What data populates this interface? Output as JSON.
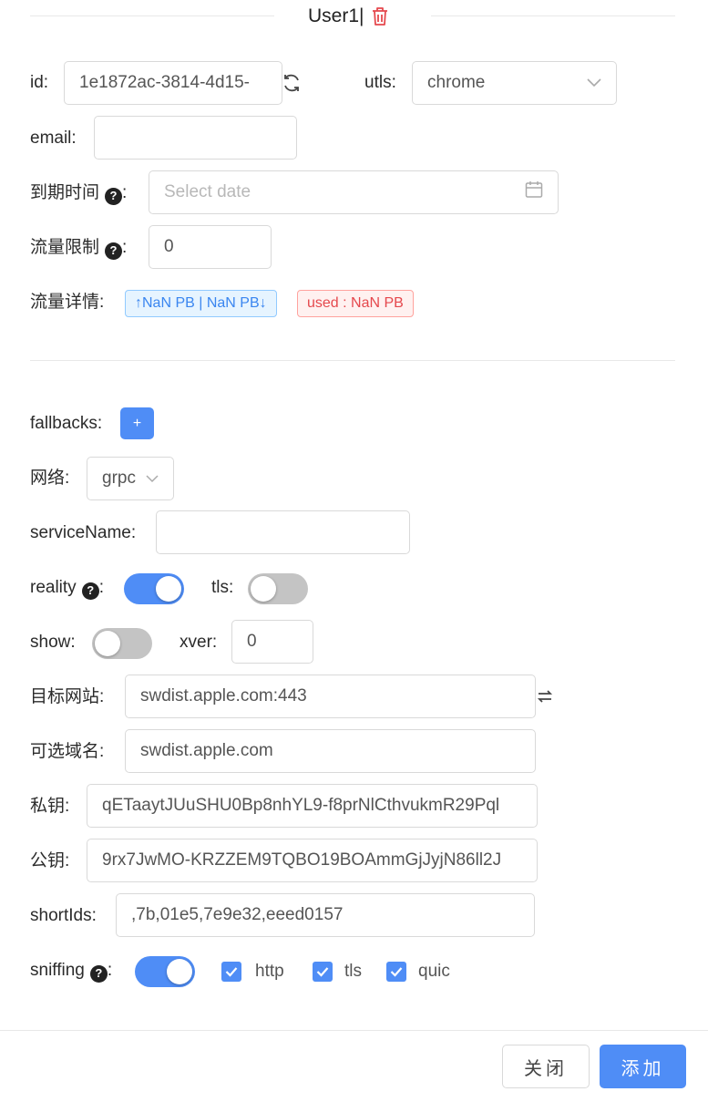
{
  "header": {
    "title": "User1|"
  },
  "client": {
    "id_label": "id",
    "id_value": "1e1872ac-3814-4d15-",
    "utls_label": "utls",
    "utls_value": "chrome",
    "email_label": "email",
    "email_value": "",
    "expiry_label": "到期时间",
    "expiry_placeholder": "Select date",
    "traffic_limit_label": "流量限制",
    "traffic_limit_value": "0",
    "traffic_detail_label": "流量详情",
    "traffic_tag_updown": "↑NaN PB | NaN PB↓",
    "traffic_tag_used": "used : NaN PB"
  },
  "stream": {
    "fallbacks_label": "fallbacks",
    "fallbacks_add": "+",
    "network_label": "网络",
    "network_value": "grpc",
    "service_name_label": "serviceName",
    "service_name_value": "",
    "reality_label": "reality",
    "reality_on": true,
    "tls_label": "tls",
    "tls_on": false,
    "show_label": "show",
    "show_on": false,
    "xver_label": "xver",
    "xver_value": "0",
    "target_label": "目标网站",
    "target_value": "swdist.apple.com:443",
    "server_names_label": "可选域名",
    "server_names_value": "swdist.apple.com",
    "private_key_label": "私钥",
    "private_key_value": "qETaaytJUuSHU0Bp8nhYL9-f8prNlCthvukmR29Pql",
    "public_key_label": "公钥",
    "public_key_value": "9rx7JwMO-KRZZEM9TQBO19BOAmmGjJyjN86ll2J",
    "short_ids_label": "shortIds",
    "short_ids_value": ",7b,01e5,7e9e32,eeed0157",
    "sniffing_label": "sniffing",
    "sniffing_on": true,
    "sniff_http": "http",
    "sniff_tls": "tls",
    "sniff_quic": "quic"
  },
  "footer": {
    "close_label": "关闭",
    "add_label": "添加"
  },
  "colors": {
    "primary": "#4f8df6",
    "danger": "#e5484d",
    "info_bg": "#e6f4ff",
    "danger_bg": "#fff1f0"
  }
}
